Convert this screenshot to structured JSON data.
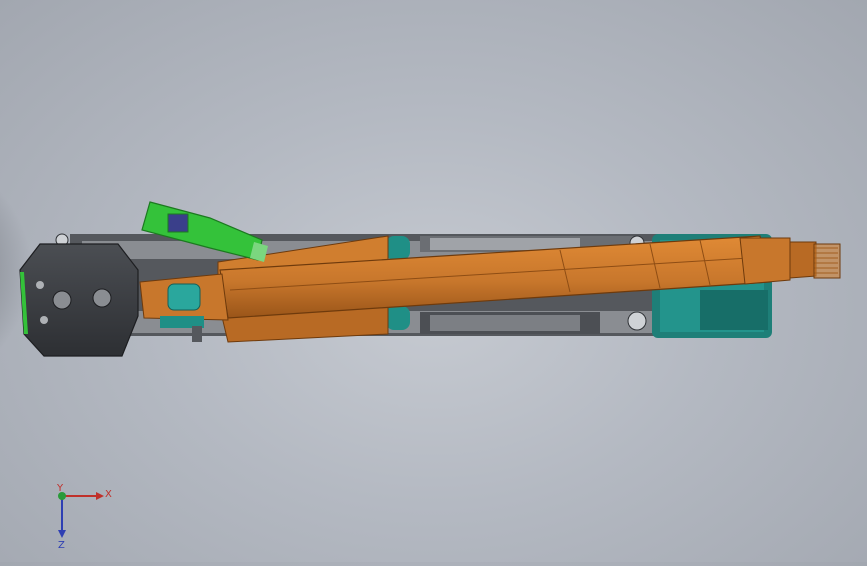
{
  "triad": {
    "x_label": "X",
    "y_label": "Y",
    "z_label": "Z"
  },
  "colors": {
    "background": "#b4b9c2",
    "boom_orange": "#c8772c",
    "boom_shadow": "#8e4d14",
    "tool_green": "#34c23a",
    "chassis_dark": "#3c3e42",
    "chassis_gray": "#8a8d92",
    "teal": "#1f8f86",
    "triad_x": "#c0302a",
    "triad_y": "#2a9a3a",
    "triad_z": "#2e3fb3"
  }
}
